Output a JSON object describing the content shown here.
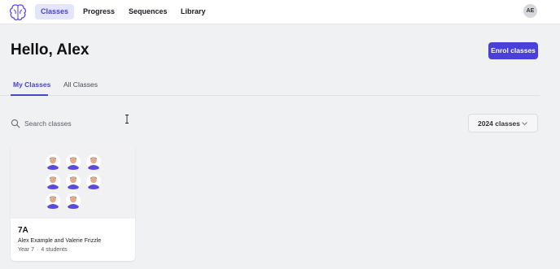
{
  "nav": {
    "logo_icon": "brain-logo-icon",
    "items": [
      {
        "label": "Classes",
        "active": true
      },
      {
        "label": "Progress",
        "active": false
      },
      {
        "label": "Sequences",
        "active": false
      },
      {
        "label": "Library",
        "active": false
      }
    ],
    "avatar_initials": "AE"
  },
  "header": {
    "greeting": "Hello, Alex",
    "enrol_button": "Enrol classes"
  },
  "tabs": [
    {
      "label": "My Classes",
      "active": true
    },
    {
      "label": "All Classes",
      "active": false
    }
  ],
  "search": {
    "placeholder": "Search classes",
    "value": "",
    "icon": "search-icon"
  },
  "year_filter": {
    "selected": "2024 classes",
    "icon": "chevron-down-icon"
  },
  "classes": [
    {
      "name": "7A",
      "teachers": "Alex Example and Valerie Frizzle",
      "year": "Year 7",
      "students": "4 students",
      "separator": "·"
    }
  ],
  "colors": {
    "accent": "#4a3fd9",
    "active_nav_bg": "#e3e5fb",
    "student_shirt": "#5b4ae0",
    "page_bg": "#f0f1f3"
  }
}
